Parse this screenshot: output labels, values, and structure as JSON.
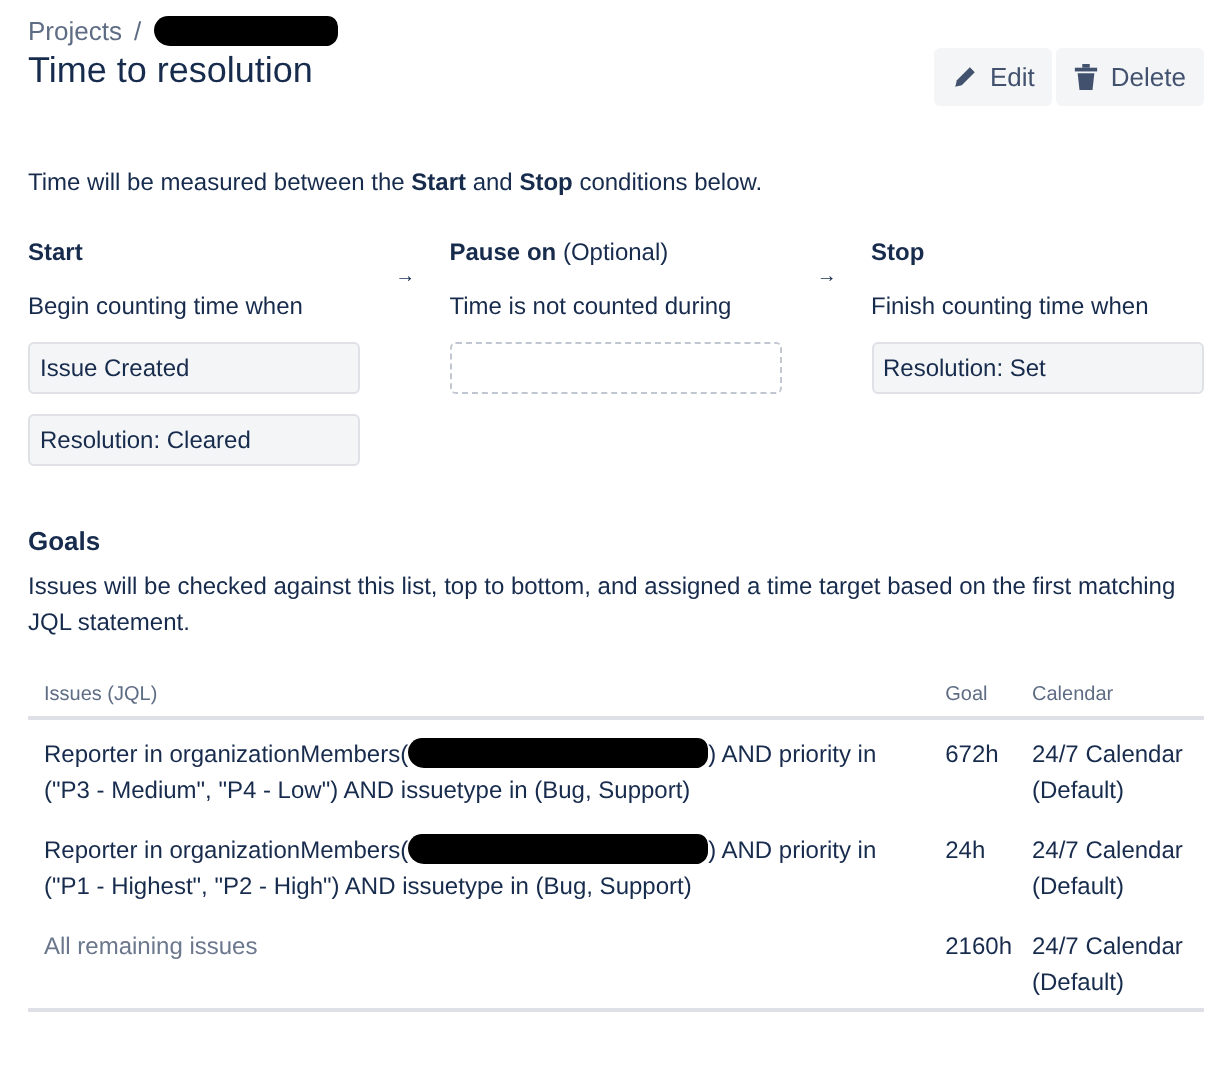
{
  "breadcrumb": {
    "link": "Projects",
    "separator": "/",
    "redacted": true
  },
  "title": "Time to resolution",
  "actions": [
    {
      "label": "Edit"
    },
    {
      "label": "Delete"
    }
  ],
  "intro": "Time will be measured between the **Start** and **Stop** conditions below.",
  "conditions": [
    {
      "heading": "Start",
      "description": "Begin counting time when",
      "items": [
        "Issue Created",
        "Resolution: Cleared"
      ]
    },
    {
      "heading": "Pause on",
      "note": "(Optional)",
      "description": "Time is not counted during"
    },
    {
      "heading": "Stop",
      "description": "Finish counting time when",
      "items": [
        "Resolution: Set"
      ]
    }
  ],
  "arrow": "→",
  "goals": {
    "heading": "Goals",
    "description": "Issues will be checked against this list, top to bottom, and assigned a time target based on the first matching JQL statement.",
    "columns": [
      "Issues (JQL)",
      "Goal",
      "Calendar"
    ],
    "rows": [
      {
        "kind": "query",
        "jql_start": "Reporter in organizationMembers(",
        "redacted": true,
        "jql_end": ") AND priority in (\"P3 - Medium\", \"P4 - Low\") AND issuetype in (Bug, Support)",
        "goal": "672h",
        "calendar": "24/7 Calendar (Default)"
      },
      {
        "kind": "query",
        "jql_start": "Reporter in organizationMembers(",
        "redacted": true,
        "jql_end": ") AND priority in (\"P1 - Highest\", \"P2 - High\") AND issuetype in (Bug, Support)",
        "goal": "24h",
        "calendar": "24/7 Calendar (Default)"
      },
      {
        "kind": "default",
        "jql_start": "All remaining issues",
        "goal": "2160h",
        "calendar": "24/7 Calendar (Default)"
      }
    ]
  }
}
